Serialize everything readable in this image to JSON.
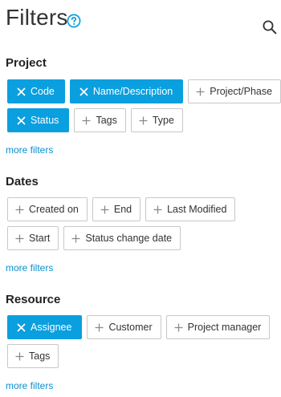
{
  "header": {
    "title": "Filters"
  },
  "sections": {
    "project": {
      "title": "Project",
      "chips": [
        {
          "label": "Code",
          "active": true
        },
        {
          "label": "Name/Description",
          "active": true
        },
        {
          "label": "Project/Phase",
          "active": false
        },
        {
          "label": "Status",
          "active": true
        },
        {
          "label": "Tags",
          "active": false
        },
        {
          "label": "Type",
          "active": false
        }
      ],
      "more": "more filters"
    },
    "dates": {
      "title": "Dates",
      "chips": [
        {
          "label": "Created on",
          "active": false
        },
        {
          "label": "End",
          "active": false
        },
        {
          "label": "Last Modified",
          "active": false
        },
        {
          "label": "Start",
          "active": false
        },
        {
          "label": "Status change date",
          "active": false
        }
      ],
      "more": "more filters"
    },
    "resource": {
      "title": "Resource",
      "chips": [
        {
          "label": "Assignee",
          "active": true
        },
        {
          "label": "Customer",
          "active": false
        },
        {
          "label": "Project manager",
          "active": false
        },
        {
          "label": "Tags",
          "active": false
        }
      ],
      "more": "more filters"
    }
  },
  "colors": {
    "accent": "#0a9fdf",
    "link": "#0a8fd0",
    "chip_border": "#c8c8c8"
  },
  "icons": {
    "help": "help-circle-icon",
    "search": "search-icon",
    "remove": "close-icon",
    "add": "plus-icon"
  }
}
